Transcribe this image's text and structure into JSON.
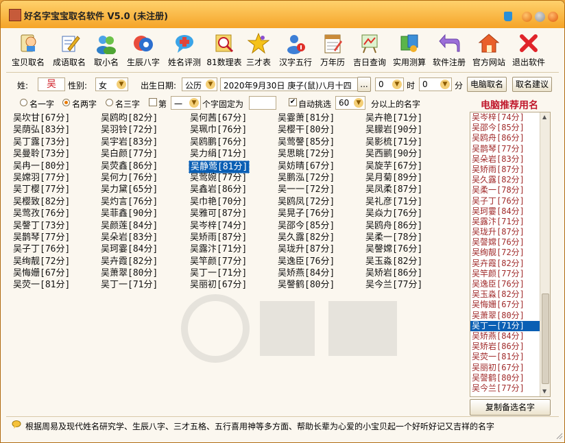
{
  "window": {
    "title": "好名字宝宝取名软件 V5.0 (未注册)"
  },
  "toolbar": [
    {
      "label": "宝贝取名",
      "icon": "baby-clipboard-icon"
    },
    {
      "label": "成语取名",
      "icon": "pencil-notepad-icon"
    },
    {
      "label": "取小名",
      "icon": "people-icon"
    },
    {
      "label": "生辰八字",
      "icon": "bagua-icon"
    },
    {
      "label": "姓名评测",
      "icon": "speech-bubble-icon"
    },
    {
      "label": "81数理表",
      "icon": "magnifier-icon"
    },
    {
      "label": "三才表",
      "icon": "star-icon"
    },
    {
      "label": "汉字五行",
      "icon": "person-info-icon"
    },
    {
      "label": "万年历",
      "icon": "calendar-icon"
    },
    {
      "label": "吉日查询",
      "icon": "easel-icon"
    },
    {
      "label": "实用测算",
      "icon": "tools-icon"
    },
    {
      "label": "软件注册",
      "icon": "return-arrow-icon"
    },
    {
      "label": "官方网站",
      "icon": "house-icon"
    },
    {
      "label": "退出软件",
      "icon": "close-x-icon"
    }
  ],
  "form": {
    "surname_label": "姓:",
    "surname_value": "吴",
    "gender_label": "性别:",
    "gender_value": "女",
    "birth_label": "出生日期:",
    "calendar_type": "公历",
    "date_text": "2020年9月30日 庚子(鼠)八月十四",
    "date_btn": "...",
    "hour_value": "0",
    "hour_label": "时",
    "minute_value": "0",
    "minute_label": "分",
    "computer_btn": "电脑取名",
    "suggest_btn": "取名建议"
  },
  "options": {
    "opt1": "名一字",
    "opt2": "名两字",
    "opt3": "名三字",
    "fixed_prefix": "第",
    "fixed_pos": "一",
    "fixed_suffix": "个字固定为",
    "fixed_value": "",
    "auto_label": "自动挑选",
    "score_value": "60",
    "score_suffix": "分以上的名字"
  },
  "names": [
    [
      "吴坎甘[67分]",
      "吴荫弘[83分]",
      "吴丁露[73分]",
      "吴曼聆[73分]",
      "吴冉一[80分]",
      "吴嫦羽[77分]",
      "吴丁樱[77分]",
      "吴樱致[82分]",
      "吴莺孜[76分]",
      "吴謦丁[73分]",
      "吴鹊琴[77分]",
      "吴子丁[76分]",
      "吴绚靓[72分]",
      "吴悔姗[67分]",
      "吴荧一[81分]"
    ],
    [
      "吴鸥昀[82分]",
      "吴羽铃[72分]",
      "吴宇岩[83分]",
      "吴白颜[77分]",
      "吴荧鑫[86分]",
      "吴何力[76分]",
      "吴力黛[65分]",
      "吴灼言[76分]",
      "吴菲鑫[90分]",
      "吴颜莲[84分]",
      "吴朵岩[83分]",
      "吴珂霎[84分]",
      "吴卉霞[82分]",
      "吴萧翠[80分]",
      "吴丁一[71分]"
    ],
    [
      "吴何茜[67分]",
      "吴珮巾[76分]",
      "吴鸥鹏[76分]",
      "吴力绢[71分]",
      "吴静莺[81分]",
      "吴莺婉[77分]",
      "吴鑫岩[86分]",
      "吴巾艳[70分]",
      "吴雅可[87分]",
      "吴岑梓[74分]",
      "吴矫雨[87分]",
      "吴露汴[71分]",
      "吴竿颜[77分]",
      "吴丁一[71分]",
      "吴丽初[67分]"
    ],
    [
      "吴霎萧[81分]",
      "吴樱干[80分]",
      "吴莺謦[85分]",
      "吴思眺[72分]",
      "吴妨晴[67分]",
      "吴鹏泓[72分]",
      "吴一一[72分]",
      "吴鸥凤[72分]",
      "吴晃子[76分]",
      "吴邵今[85分]",
      "吴久露[82分]",
      "吴珑升[87分]",
      "吴逸臣[76分]",
      "吴矫燕[84分]",
      "吴謦鹤[80分]"
    ],
    [
      "吴卉艳[71分]",
      "吴朦岩[90分]",
      "吴影梳[71分]",
      "吴西鹂[90分]",
      "吴旋芋[67分]",
      "吴月菊[89分]",
      "吴凤柔[87分]",
      "吴礼彦[71分]",
      "吴焱力[76分]",
      "吴鸥舟[86分]",
      "吴柔一[78分]",
      "吴謦嫦[76分]",
      "吴玉淼[82分]",
      "吴矫岩[86分]",
      "吴今兰[77分]"
    ]
  ],
  "selected_name": "吴静莺[81分]",
  "recommend": {
    "title": "电脑推荐用名",
    "items": [
      "吴岑梓[74分]",
      "吴邵今[85分]",
      "吴鸥舟[86分]",
      "吴鹊琴[77分]",
      "吴朵岩[83分]",
      "吴矫雨[87分]",
      "吴久露[82分]",
      "吴柔一[78分]",
      "吴子丁[76分]",
      "吴珂霎[84分]",
      "吴露汴[71分]",
      "吴珑升[87分]",
      "吴謦嫦[76分]",
      "吴绚靓[72分]",
      "吴卉霞[82分]",
      "吴竿颜[77分]",
      "吴逸臣[76分]",
      "吴玉淼[82分]",
      "吴悔姗[67分]",
      "吴萧翠[80分]",
      "吴丁一[71分]",
      "吴矫燕[84分]",
      "吴矫岩[86分]",
      "吴荧一[81分]",
      "吴丽初[67分]",
      "吴謦鹤[80分]",
      "吴今兰[77分]"
    ],
    "selected_index": 20,
    "copy_btn": "复制备选名字"
  },
  "status": "根据周易及现代姓名研究学、生辰八字、三才五格、五行喜用神等多方面、帮助长辈为心爱的小宝贝起一个好听好记又吉祥的名字",
  "colors": {
    "title_gradient_top": "#ffd16c",
    "title_gradient_bottom": "#f5a428",
    "accent_red": "#c0182c",
    "selection_blue": "#0a5fb4",
    "name_text_recommend": "#a02a2a"
  }
}
